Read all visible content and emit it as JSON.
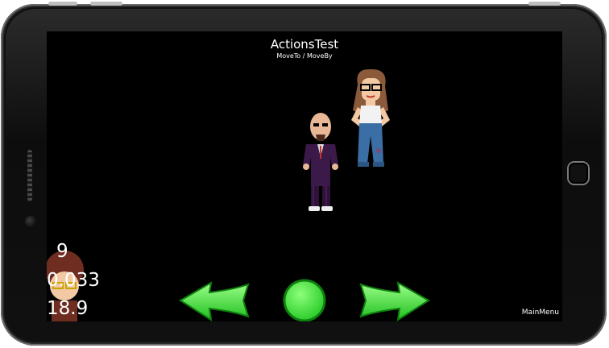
{
  "scene": {
    "title": "ActionsTest",
    "subtitle": "MoveTo / MoveBy"
  },
  "stats": {
    "draw_calls": "9",
    "frame_time": "0.033",
    "fps": "18.9"
  },
  "controls": {
    "back_icon": "left-arrow-icon",
    "restart_icon": "circle-icon",
    "next_icon": "right-arrow-icon",
    "color": "#44ee44"
  },
  "menu": {
    "main_menu_label": "MainMenu"
  },
  "colors": {
    "screen_background": "#000000",
    "text": "#ffffff"
  }
}
